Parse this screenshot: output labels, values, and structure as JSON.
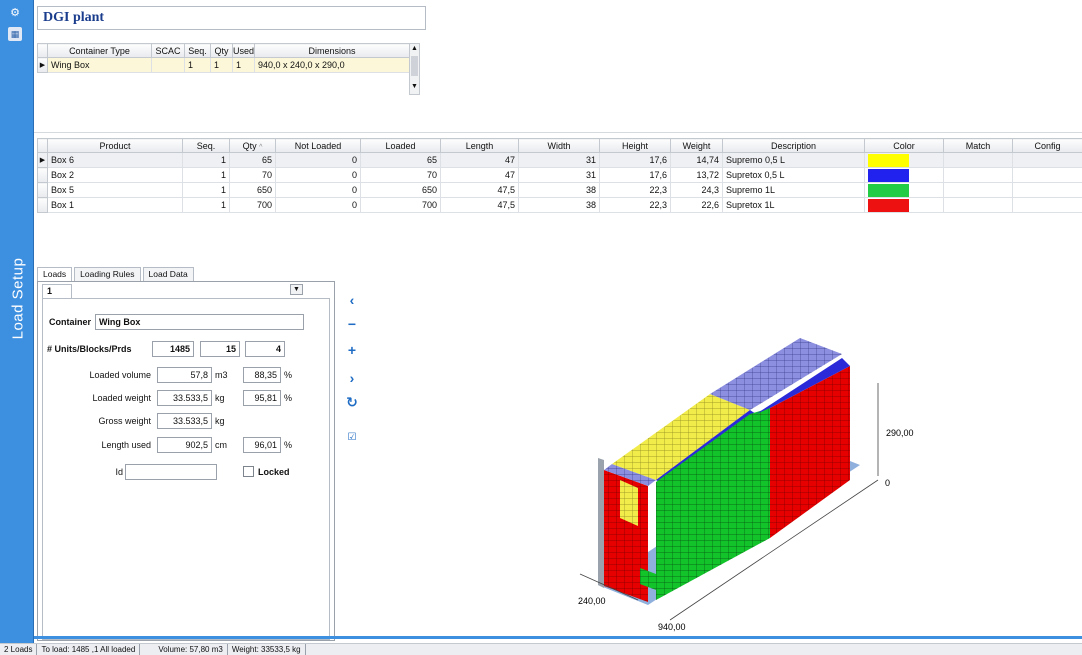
{
  "plant_title": "DGI plant",
  "container_table": {
    "headers": [
      "Container Type",
      "SCAC",
      "Seq.",
      "Qty",
      "Used",
      "Dimensions"
    ],
    "rows": [
      [
        "Wing Box",
        "",
        "1",
        "1",
        "1",
        "940,0 x 240,0 x 290,0"
      ]
    ]
  },
  "product_table": {
    "headers": [
      "Product",
      "Seq.",
      "Qty",
      "Not Loaded",
      "Loaded",
      "Length",
      "Width",
      "Height",
      "Weight",
      "Description",
      "Color",
      "Match",
      "Config"
    ],
    "sort_indicator": "^",
    "rows": [
      {
        "cells": [
          "Box 6",
          "1",
          "65",
          "0",
          "65",
          "47",
          "31",
          "17,6",
          "14,74",
          "Supremo 0,5 L"
        ],
        "color": "#ffff00"
      },
      {
        "cells": [
          "Box 2",
          "1",
          "70",
          "0",
          "70",
          "47",
          "31",
          "17,6",
          "13,72",
          "Supretox 0,5 L"
        ],
        "color": "#2222ee"
      },
      {
        "cells": [
          "Box 5",
          "1",
          "650",
          "0",
          "650",
          "47,5",
          "38",
          "22,3",
          "24,3",
          "Supremo 1L"
        ],
        "color": "#22cc44"
      },
      {
        "cells": [
          "Box 1",
          "1",
          "700",
          "0",
          "700",
          "47,5",
          "38",
          "22,3",
          "22,6",
          "Supretox 1L"
        ],
        "color": "#ee1111"
      }
    ]
  },
  "tabs": [
    "Loads",
    "Loading Rules",
    "Load Data"
  ],
  "subtab": "1",
  "form": {
    "container_label": "Container",
    "container_value": "Wing Box",
    "units_label": "# Units/Blocks/Prds",
    "units": "1485",
    "blocks": "15",
    "prds": "4",
    "loaded_volume_label": "Loaded volume",
    "loaded_volume": "57,8",
    "loaded_volume_unit": "m3",
    "loaded_volume_pct": "88,35",
    "loaded_weight_label": "Loaded weight",
    "loaded_weight": "33.533,5",
    "loaded_weight_unit": "kg",
    "loaded_weight_pct": "95,81",
    "gross_weight_label": "Gross weight",
    "gross_weight": "33.533,5",
    "gross_weight_unit": "kg",
    "length_used_label": "Length used",
    "length_used": "902,5",
    "length_used_unit": "cm",
    "length_used_pct": "96,01",
    "pct": "%",
    "id_label": "Id",
    "id_value": "",
    "locked_label": "Locked"
  },
  "sidebar": {
    "label": "Load Setup"
  },
  "view3d": {
    "dim_height": "290,00",
    "dim_zero": "0",
    "dim_width": "240,00",
    "dim_length": "940,00"
  },
  "status": [
    "2 Loads",
    "To load: 1485 ,1 All loaded",
    "Volume: 57,80 m3",
    "Weight: 33533,5 kg"
  ]
}
